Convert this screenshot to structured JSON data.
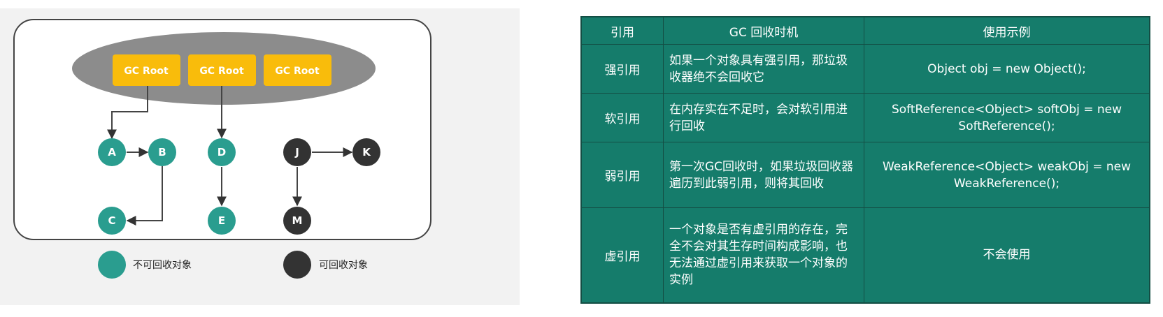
{
  "diagram": {
    "roots": [
      "GC Root",
      "GC Root",
      "GC Root"
    ],
    "nodes": {
      "A": "A",
      "B": "B",
      "C": "C",
      "D": "D",
      "E": "E",
      "J": "J",
      "K": "K",
      "M": "M"
    },
    "legend": {
      "reachable": "不可回收对象",
      "unreachable": "可回收对象"
    },
    "colors": {
      "reachable": "#2a9d8f",
      "unreachable": "#333333",
      "root": "#f9bc0b",
      "root_area": "#8c8c8c"
    }
  },
  "table": {
    "headers": [
      "引用",
      "GC 回收时机",
      "使用示例"
    ],
    "rows": [
      {
        "type": "强引用",
        "timing": "如果一个对象具有强引用，那垃圾收器绝不会回收它",
        "example": "Object obj = new Object();"
      },
      {
        "type": "软引用",
        "timing": "在内存实在不足时，会对软引用进行回收",
        "example": "SoftReference<Object> softObj = new SoftReference();"
      },
      {
        "type": "弱引用",
        "timing": "第一次GC回收时，如果垃圾回收器遍历到此弱引用，则将其回收",
        "example": "WeakReference<Object> weakObj = new WeakReference();"
      },
      {
        "type": "虚引用",
        "timing": "一个对象是否有虚引用的存在，完全不会对其生存时间构成影响，也无法通过虚引用来获取一个对象的实例",
        "example": "不会使用"
      }
    ],
    "colors": {
      "cell_bg": "#157c6b",
      "border": "#134e44"
    }
  }
}
